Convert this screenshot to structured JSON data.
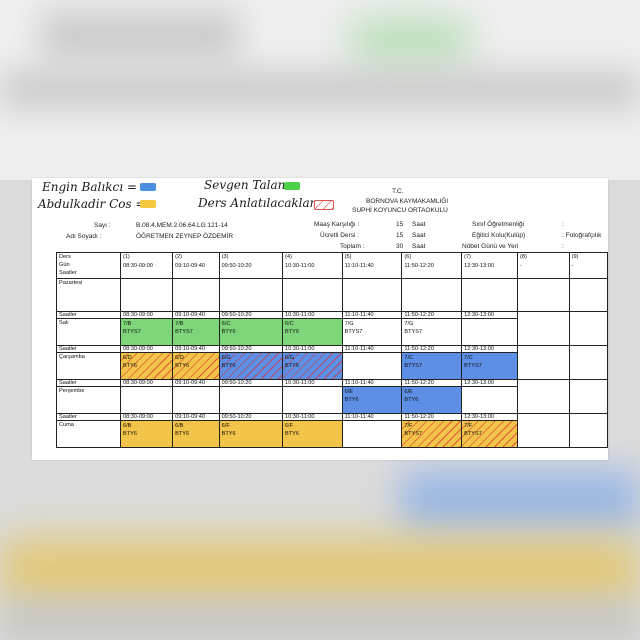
{
  "legend": {
    "engin": {
      "label": "Engin Balıkcı =",
      "color": "#4a90e2"
    },
    "sevgen": {
      "label": "Sevgen Talan =",
      "color": "#4cd14c"
    },
    "abdulkadir": {
      "label": "Abdulkadir Cos =",
      "color": "#f5c842"
    },
    "ders": {
      "label": "Ders Anlatılacaklar =",
      "color": "#e57373"
    }
  },
  "header": {
    "tc": "T.C.",
    "kaymakamlik": "BORNOVA KAYMAKAMLIĞI",
    "okul": "SUPHİ KOYUNCU ORTAOKULU",
    "sayi_label": "Sayı :",
    "sayi_value": "B.08.4.MEM.2.06.64.LG.121-14",
    "adsoyad_label": "Adı Soyadı :",
    "adsoyad_value": "ÖĞRETMEN ZEYNEP ÖZDEMİR",
    "maas_label": "Maaş Karşılığı :",
    "maas_value": "15",
    "maas_unit": "Saat",
    "ucretli_label": "Ücretli Dersi :",
    "ucretli_value": "15",
    "ucretli_unit": "Saat",
    "toplam_label": "Toplam :",
    "toplam_value": "30",
    "toplam_unit": "Saat",
    "sinif_label": "Sınıf Öğretmenliği",
    "sinif_sep": ":",
    "egitici_label": "Eğitici Kolu(Kulüp)",
    "egitici_value": ": Fotoğrafçılık",
    "nobet_label": "Nöbet Günü ve Yeri",
    "nobet_sep": ":"
  },
  "table": {
    "corner": [
      "Ders",
      "Gün",
      "Saatler"
    ],
    "columns": [
      {
        "num": "(1)",
        "time": "08:30-09:00"
      },
      {
        "num": "(2)",
        "time": "09:10-09:40"
      },
      {
        "num": "(3)",
        "time": "09:50-10:20"
      },
      {
        "num": "(4)",
        "time": "10:30-11:00"
      },
      {
        "num": "(5)",
        "time": "11:10-11:40"
      },
      {
        "num": "(6)",
        "time": "11:50-12:20"
      },
      {
        "num": "(7)",
        "time": "12:30-13:00"
      },
      {
        "num": "(8)",
        "time": "-"
      },
      {
        "num": "(9)",
        "time": "-"
      }
    ],
    "days": [
      {
        "name": "Pazartesi",
        "saatler": "",
        "cells": [
          null,
          null,
          null,
          null,
          null,
          null,
          null,
          null,
          null
        ]
      },
      {
        "name": "Salı",
        "saatler": "Saatler",
        "cells": [
          {
            "time": "08:30-09:00",
            "c": "7/B",
            "l": "BTYS7",
            "hl": "green"
          },
          {
            "time": "09:10-09:40",
            "c": "7/B",
            "l": "BTYS7",
            "hl": "green"
          },
          {
            "time": "09:50-10:20",
            "c": "6/C",
            "l": "BTY6",
            "hl": "green"
          },
          {
            "time": "10:30-11:00",
            "c": "6/C",
            "l": "BTY6",
            "hl": "green"
          },
          {
            "time": "11:10-11:40",
            "c": "7/G",
            "l": "BTYS7",
            "hl": ""
          },
          {
            "time": "11:50-12:20",
            "c": "7/G",
            "l": "BTYS7",
            "hl": ""
          },
          {
            "time": "12:30-13:00",
            "c": "",
            "l": "",
            "hl": ""
          },
          null,
          null
        ]
      },
      {
        "name": "Çarşamba",
        "saatler": "Saatler",
        "cells": [
          {
            "time": "08:30-09:00",
            "c": "6/D",
            "l": "BTY6",
            "hl": "yellow-hatch"
          },
          {
            "time": "09:10-09:40",
            "c": "6/D",
            "l": "BTY6",
            "hl": "yellow-hatch"
          },
          {
            "time": "09:50-10:20",
            "c": "6/G",
            "l": "BTY6",
            "hl": "blue-hatch"
          },
          {
            "time": "10:30-11:00",
            "c": "6/G",
            "l": "BTY6",
            "hl": "blue-hatch"
          },
          {
            "time": "11:10-11:40",
            "c": "",
            "l": "",
            "hl": ""
          },
          {
            "time": "11:50-12:20",
            "c": "7/C",
            "l": "BTYS7",
            "hl": "blue"
          },
          {
            "time": "12:30-13:00",
            "c": "7/C",
            "l": "BTYS7",
            "hl": "blue"
          },
          null,
          null
        ]
      },
      {
        "name": "Perşembe",
        "saatler": "Saatler",
        "cells": [
          {
            "time": "08:30-09:00",
            "c": "",
            "l": "",
            "hl": ""
          },
          {
            "time": "09:10-09:40",
            "c": "",
            "l": "",
            "hl": ""
          },
          {
            "time": "09:50-10:20",
            "c": "",
            "l": "",
            "hl": ""
          },
          {
            "time": "10:30-11:00",
            "c": "",
            "l": "",
            "hl": ""
          },
          {
            "time": "11:10-11:40",
            "c": "6/E",
            "l": "BTY6",
            "hl": "blue"
          },
          {
            "time": "11:50-12:20",
            "c": "6/E",
            "l": "BTY6",
            "hl": "blue"
          },
          {
            "time": "12:30-13:00",
            "c": "",
            "l": "",
            "hl": ""
          },
          null,
          null
        ]
      },
      {
        "name": "Cuma",
        "saatler": "Saatler",
        "cells": [
          {
            "time": "08:30-09:00",
            "c": "6/B",
            "l": "BTY6",
            "hl": "yellow"
          },
          {
            "time": "09:10-09:40",
            "c": "6/B",
            "l": "BTY6",
            "hl": "yellow"
          },
          {
            "time": "09:50-10:20",
            "c": "6/F",
            "l": "BTY6",
            "hl": "yellow"
          },
          {
            "time": "10:30-11:00",
            "c": "6/F",
            "l": "BTY6",
            "hl": "yellow"
          },
          {
            "time": "11:10-11:40",
            "c": "",
            "l": "",
            "hl": ""
          },
          {
            "time": "11:50-12:20",
            "c": "7/F",
            "l": "BTYS7",
            "hl": "yellow-hatch"
          },
          {
            "time": "12:30-13:00",
            "c": "7/F",
            "l": "BTYS7",
            "hl": "yellow-hatch"
          },
          null,
          null
        ]
      }
    ]
  }
}
